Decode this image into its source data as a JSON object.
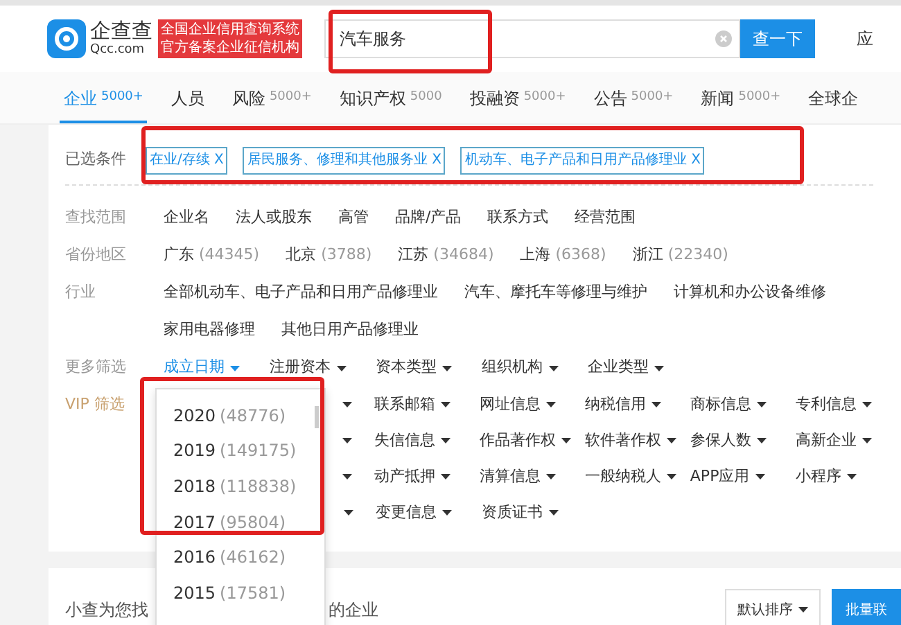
{
  "header": {
    "logo_name": "企查查",
    "logo_domain": "Qcc.com",
    "slogan": [
      "全国企业信用查询系统",
      "官方备案企业征信机构"
    ],
    "search": {
      "value": "汽车服务"
    },
    "search_button": "查一下",
    "nav_link": "应"
  },
  "tabs": [
    {
      "label": "企业",
      "count": "5000+",
      "selected": true
    },
    {
      "label": "人员",
      "selected": false
    },
    {
      "label": "风险",
      "count": "5000+",
      "selected": false
    },
    {
      "label": "知识产权",
      "count": "5000",
      "selected": false
    },
    {
      "label": "投融资",
      "count": "5000+",
      "selected": false
    },
    {
      "label": "公告",
      "count": "5000+",
      "selected": false
    },
    {
      "label": "新闻",
      "count": "5000+",
      "selected": false
    },
    {
      "label": "全球企",
      "selected": false
    }
  ],
  "selected_conditions": {
    "label": "已选条件",
    "tags": [
      {
        "label": "在业/存续",
        "remove": "X"
      },
      {
        "label": "居民服务、修理和其他服务业",
        "remove": "X"
      },
      {
        "label": "机动车、电子产品和日用产品修理业",
        "remove": "X"
      }
    ]
  },
  "filters": [
    {
      "label": "查找范围",
      "lines": [
        [
          {
            "name": "企业名"
          },
          {
            "name": "法人或股东"
          },
          {
            "name": "高管"
          },
          {
            "name": "品牌/产品"
          },
          {
            "name": "联系方式"
          },
          {
            "name": "经营范围"
          }
        ]
      ]
    },
    {
      "label": "省份地区",
      "lines": [
        [
          {
            "name": "广东",
            "count": "(44345)"
          },
          {
            "name": "北京",
            "count": "(3788)"
          },
          {
            "name": "江苏",
            "count": "(34684)"
          },
          {
            "name": "上海",
            "count": "(6368)"
          },
          {
            "name": "浙江",
            "count": "(22340)"
          }
        ]
      ]
    },
    {
      "label": "行业",
      "lines": [
        [
          {
            "name": "全部机动车、电子产品和日用产品修理业"
          },
          {
            "name": "汽车、摩托车等修理与维护"
          },
          {
            "name": "计算机和办公设备维修"
          }
        ],
        [
          {
            "name": "家用电器修理"
          },
          {
            "name": "其他日用产品修理业"
          }
        ]
      ]
    }
  ],
  "more_filters": {
    "label": "更多筛选",
    "items": [
      {
        "name": "成立日期",
        "selected": true
      },
      {
        "name": "注册资本",
        "selected": false
      },
      {
        "name": "资本类型",
        "selected": false
      },
      {
        "name": "组织机构",
        "selected": false
      },
      {
        "name": "企业类型",
        "selected": false
      }
    ]
  },
  "vip_filters": {
    "label": "VIP 筛选",
    "rows": [
      [
        "联系邮箱",
        "网址信息",
        "纳税信用",
        "商标信息",
        "专利信息"
      ],
      [
        "失信信息",
        "作品著作权",
        "软件著作权",
        "参保人数",
        "高新企业"
      ],
      [
        "动产抵押",
        "清算信息",
        "一般纳税人",
        "APP应用",
        "小程序"
      ],
      [
        "变更信息",
        "资质证书"
      ]
    ]
  },
  "date_dropdown": {
    "options": [
      {
        "year": "2020",
        "count": "(48776)"
      },
      {
        "year": "2019",
        "count": "(149175)"
      },
      {
        "year": "2018",
        "count": "(118838)"
      },
      {
        "year": "2017",
        "count": "(95804)"
      },
      {
        "year": "2016",
        "count": "(46162)"
      },
      {
        "year": "2015",
        "count": "(17581)"
      }
    ]
  },
  "results": {
    "text_start": "小查为您找",
    "text_end": "的企业",
    "sort_button": "默认排序",
    "batch_button": "批量联"
  }
}
